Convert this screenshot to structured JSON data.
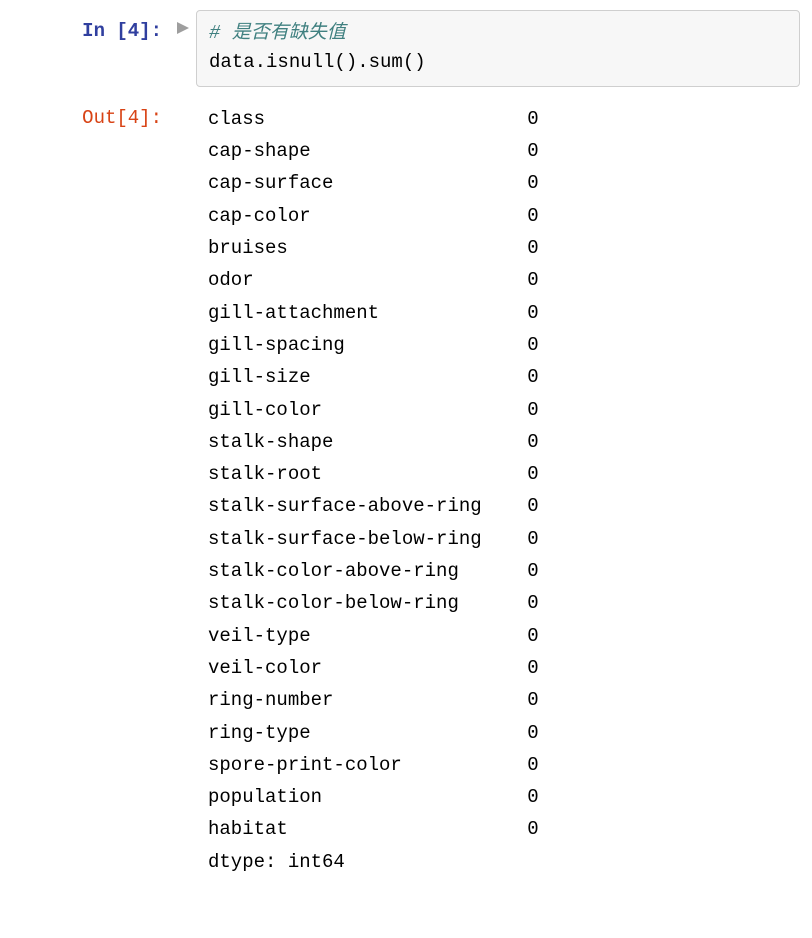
{
  "in_prompt": "In [4]:",
  "out_prompt": "Out[4]:",
  "code": {
    "comment": "# 是否有缺失值",
    "line": "data.isnull().sum()"
  },
  "series": [
    {
      "name": "class",
      "value": "0"
    },
    {
      "name": "cap-shape",
      "value": "0"
    },
    {
      "name": "cap-surface",
      "value": "0"
    },
    {
      "name": "cap-color",
      "value": "0"
    },
    {
      "name": "bruises",
      "value": "0"
    },
    {
      "name": "odor",
      "value": "0"
    },
    {
      "name": "gill-attachment",
      "value": "0"
    },
    {
      "name": "gill-spacing",
      "value": "0"
    },
    {
      "name": "gill-size",
      "value": "0"
    },
    {
      "name": "gill-color",
      "value": "0"
    },
    {
      "name": "stalk-shape",
      "value": "0"
    },
    {
      "name": "stalk-root",
      "value": "0"
    },
    {
      "name": "stalk-surface-above-ring",
      "value": "0"
    },
    {
      "name": "stalk-surface-below-ring",
      "value": "0"
    },
    {
      "name": "stalk-color-above-ring",
      "value": "0"
    },
    {
      "name": "stalk-color-below-ring",
      "value": "0"
    },
    {
      "name": "veil-type",
      "value": "0"
    },
    {
      "name": "veil-color",
      "value": "0"
    },
    {
      "name": "ring-number",
      "value": "0"
    },
    {
      "name": "ring-type",
      "value": "0"
    },
    {
      "name": "spore-print-color",
      "value": "0"
    },
    {
      "name": "population",
      "value": "0"
    },
    {
      "name": "habitat",
      "value": "0"
    }
  ],
  "dtype_line": "dtype: int64",
  "pad_width": 28
}
